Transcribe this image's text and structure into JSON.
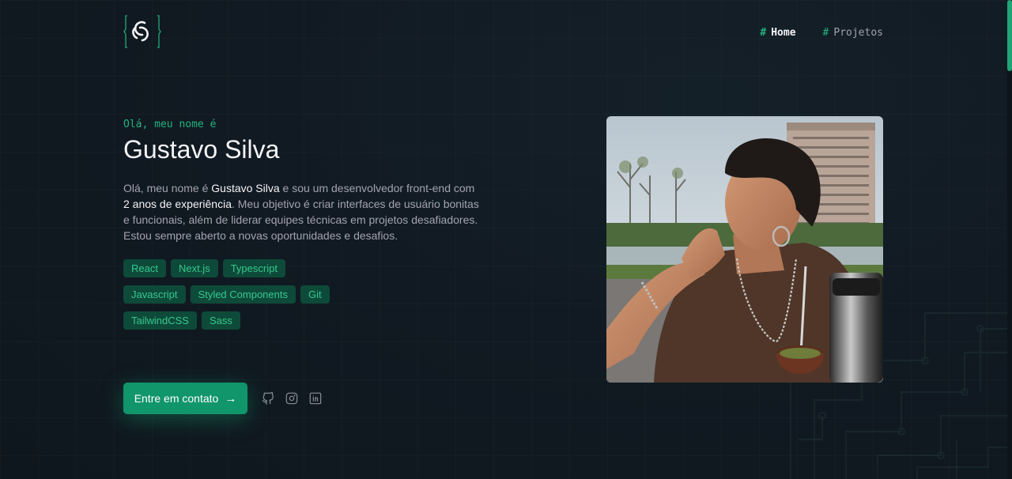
{
  "nav": {
    "items": [
      {
        "hash": "#",
        "label": "Home",
        "active": true
      },
      {
        "hash": "#",
        "label": "Projetos",
        "active": false
      }
    ]
  },
  "hero": {
    "greeting": "Olá, meu nome é",
    "name": "Gustavo Silva",
    "bio": {
      "p1": "Olá, meu nome é ",
      "b1": "Gustavo Silva",
      "p2": " e sou um desenvolvedor front-end com ",
      "b2": "2 anos de experiência",
      "p3": ". Meu objetivo é criar interfaces de usuário bonitas e funcionais, além de liderar equipes técnicas em projetos desafiadores. Estou sempre aberto a novas oportunidades e desafios."
    },
    "tags": {
      "row1": [
        "React",
        "Next.js",
        "Typescript"
      ],
      "row2": [
        "Javascript",
        "Styled Components",
        "Git"
      ],
      "row3": [
        "TailwindCSS",
        "Sass"
      ]
    },
    "cta_label": "Entre em contato",
    "cta_arrow": "→",
    "socials": [
      "github-icon",
      "instagram-icon",
      "linkedin-icon"
    ]
  },
  "colors": {
    "accent": "#24b47e",
    "tag_bg": "#0e4a39",
    "button": "#11956b",
    "background": "#111a22"
  }
}
